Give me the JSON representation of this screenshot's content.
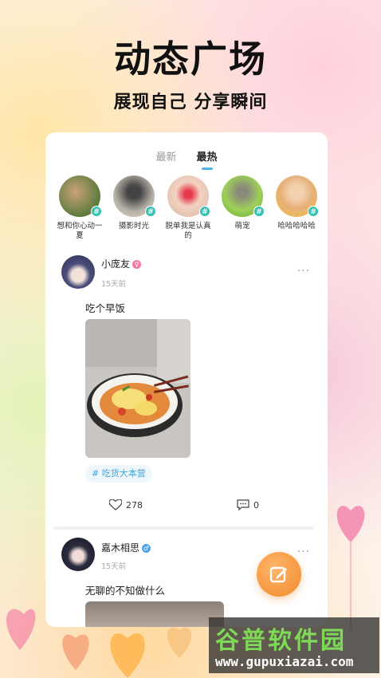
{
  "hero": {
    "title": "动态广场",
    "subtitle": "展现自己 分享瞬间"
  },
  "tabs": [
    {
      "label": "最新",
      "active": false
    },
    {
      "label": "最热",
      "active": true
    }
  ],
  "topics": [
    {
      "label": "想和你心动一夏"
    },
    {
      "label": "摄影时光"
    },
    {
      "label": "脱单我是认真的"
    },
    {
      "label": "萌宠"
    },
    {
      "label": "哈哈哈哈哈"
    }
  ],
  "topic_badge": "#",
  "posts": [
    {
      "user": "小庞友",
      "time": "15天前",
      "text": "吃个早饭",
      "tag": "# 吃货大本营",
      "likes": "278",
      "comments": "0",
      "more": "···"
    },
    {
      "user": "嘉木相思",
      "time": "15天前",
      "text": "无聊的不知做什么",
      "more": "···"
    }
  ],
  "watermark": {
    "title": "谷普软件园",
    "url": "www.gupuxiazai.com"
  },
  "colors": {
    "accent": "#4db3e8",
    "topic_badge": "#35c2b2",
    "fab": "#f08a2a"
  }
}
